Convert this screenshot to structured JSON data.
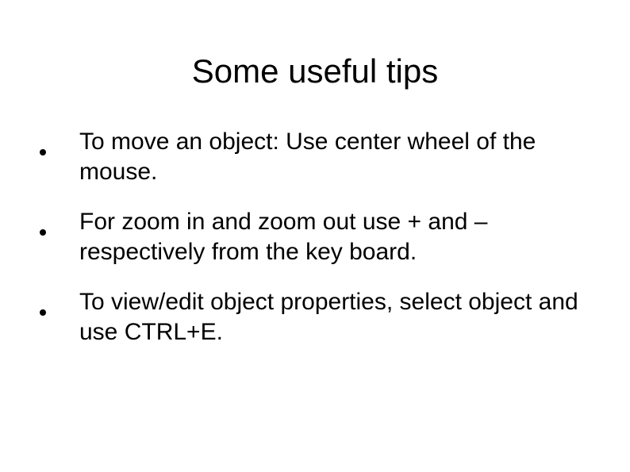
{
  "slide": {
    "title": "Some useful tips",
    "bullets": [
      "To move an object: Use center wheel of the mouse.",
      "For zoom in and zoom out use + and – respectively from the key board.",
      "To view/edit object properties, select object and use CTRL+E."
    ]
  }
}
